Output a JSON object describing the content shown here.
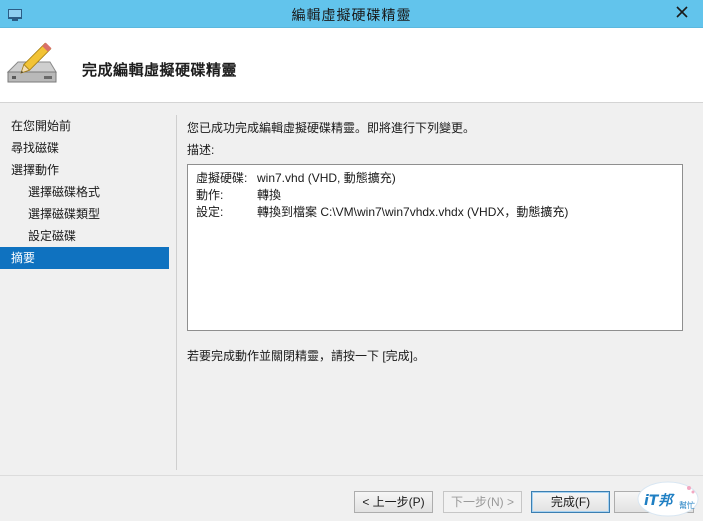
{
  "window": {
    "title": "編輯虛擬硬碟精靈",
    "close_glyph": "✕",
    "titlebar_color": "#62c4ec"
  },
  "header": {
    "heading": "完成編輯虛擬硬碟精靈",
    "icon": "disk-pencil-icon"
  },
  "nav": {
    "items": [
      {
        "label": "在您開始前",
        "level": 0,
        "active": false
      },
      {
        "label": "尋找磁碟",
        "level": 0,
        "active": false
      },
      {
        "label": "選擇動作",
        "level": 0,
        "active": false
      },
      {
        "label": "選擇磁碟格式",
        "level": 1,
        "active": false
      },
      {
        "label": "選擇磁碟類型",
        "level": 1,
        "active": false
      },
      {
        "label": "設定磁碟",
        "level": 1,
        "active": false
      },
      {
        "label": "摘要",
        "level": 0,
        "active": true
      }
    ],
    "active_color": "#0f72c0"
  },
  "content": {
    "intro": "您已成功完成編輯虛擬硬碟精靈。即將進行下列變更。",
    "description_label": "描述:",
    "summary": [
      {
        "key": "虛擬硬碟:",
        "value": "win7.vhd (VHD, 動態擴充)"
      },
      {
        "key": "動作:",
        "value": "轉換"
      },
      {
        "key": "設定:",
        "value": "轉換到檔案 C:\\VM\\win7\\win7vhdx.vhdx (VHDX，動態擴充)"
      }
    ],
    "finish_note": "若要完成動作並關閉精靈，請按一下 [完成]。"
  },
  "footer": {
    "prev_label": "< 上一步(P)",
    "next_label": "下一步(N) >",
    "finish_label": "完成(F)",
    "cancel_label": ""
  },
  "watermark": {
    "text_main": "iT邦",
    "text_sub": "幫忙"
  }
}
